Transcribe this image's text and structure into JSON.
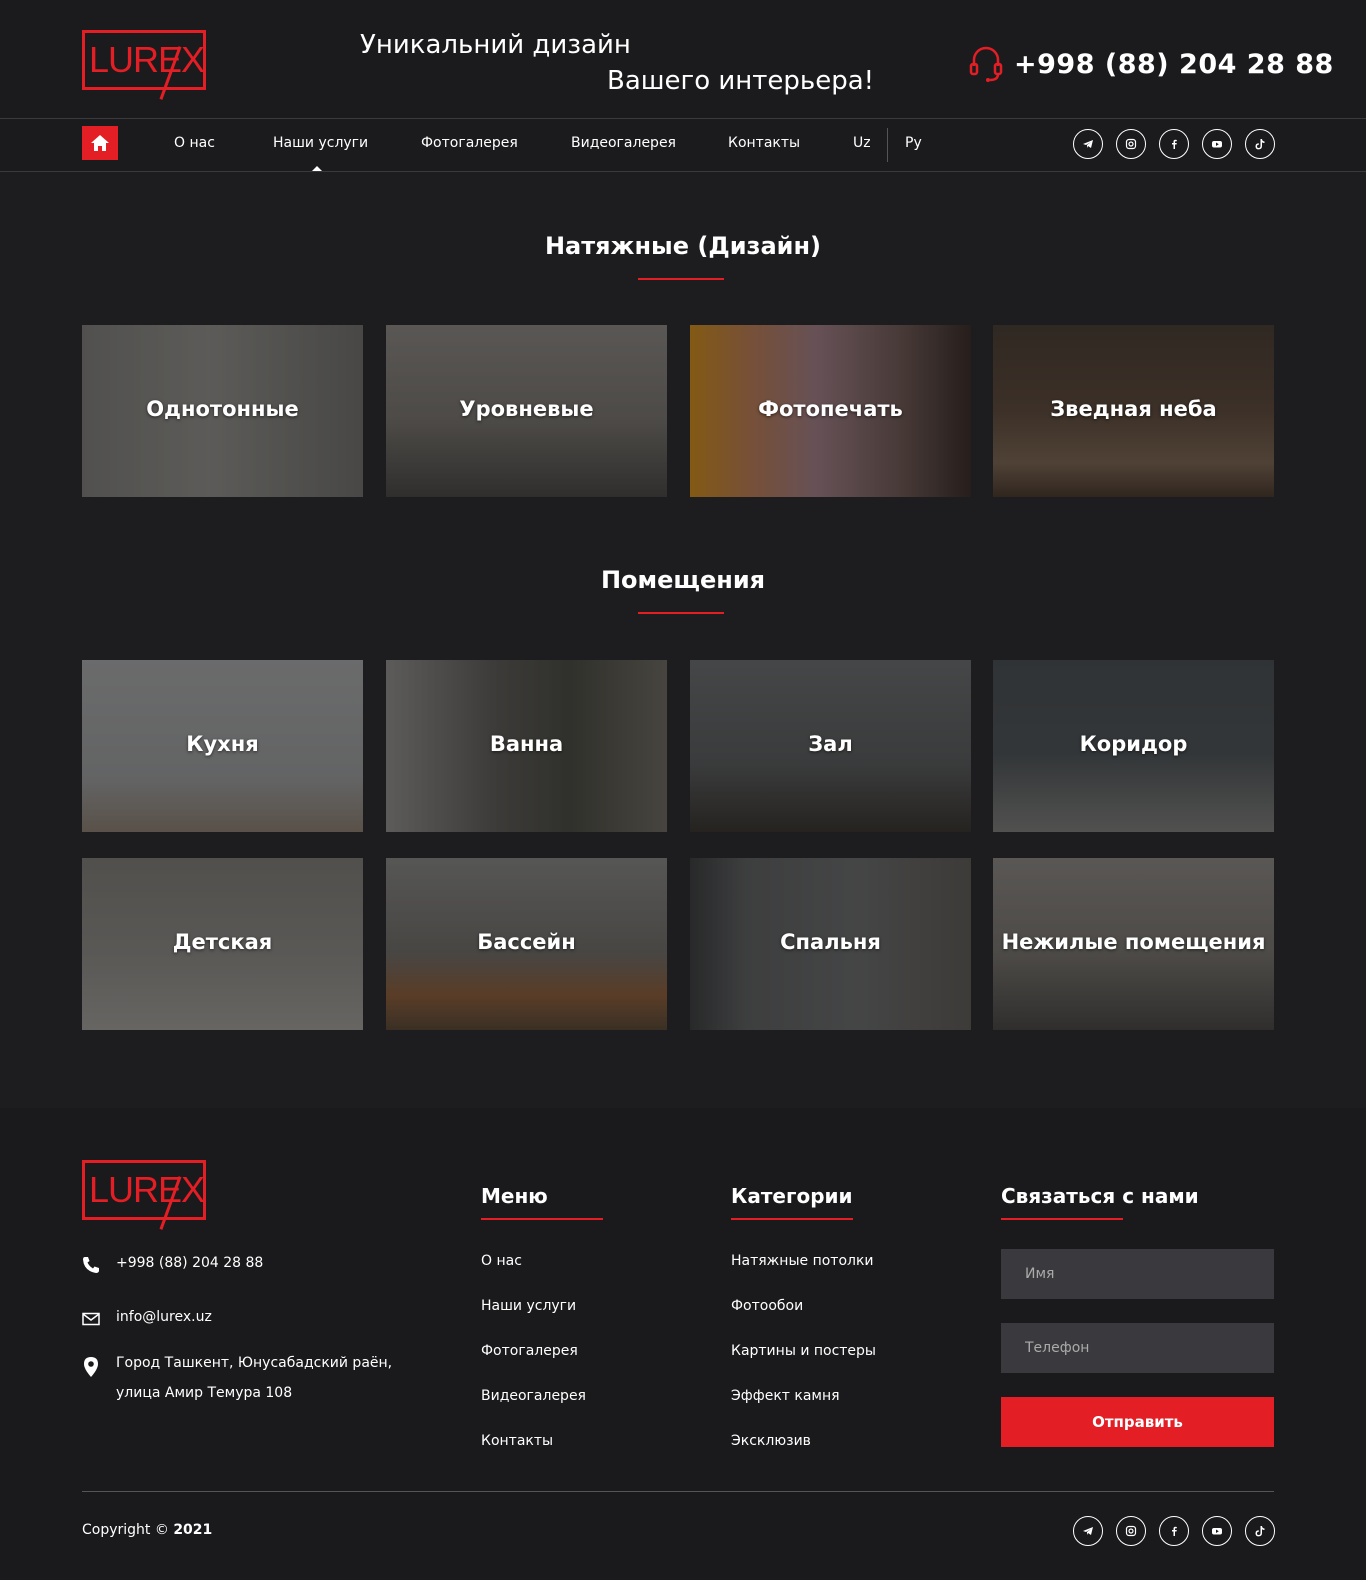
{
  "header": {
    "logo_text": "LUREX",
    "slogan_line1": "Уникальний дизайн",
    "slogan_line2": "Вашего интерьера!",
    "phone": "+998 (88) 204 28 88"
  },
  "nav": {
    "items": [
      "О нас",
      "Наши услуги",
      "Фотогалерея",
      "Видеогалерея",
      "Контакты"
    ],
    "active": "Наши услуги",
    "lang_uz": "Uz",
    "lang_ru": "Ру",
    "social_icons": [
      "telegram-icon",
      "instagram-icon",
      "facebook-icon",
      "youtube-icon",
      "tiktok-icon"
    ]
  },
  "section1": {
    "title": "Натяжные (Дизайн)",
    "cards": [
      "Однотонные",
      "Уровневые",
      "Фотопечать",
      "Зведная неба"
    ]
  },
  "section2": {
    "title": "Помещения",
    "cards": [
      "Кухня",
      "Ванна",
      "Зал",
      "Коридор",
      "Детская",
      "Бассейн",
      "Спальня",
      "Нежилые помещения"
    ]
  },
  "footer": {
    "logo_text": "LUREX",
    "phone": "+998 (88) 204 28 88",
    "email": "info@lurex.uz",
    "address_line1": "Город Ташкент, Юнусабадский раён,",
    "address_line2": "улица Амир Темура 108",
    "menu_title": "Меню",
    "menu_items": [
      "О нас",
      "Наши услуги",
      "Фотогалерея",
      "Видеогалерея",
      "Контакты"
    ],
    "categories_title": "Категории",
    "categories_items": [
      "Натяжные потолки",
      "Фотообои",
      "Картины и постеры",
      "Эффект камня",
      "Эксклюзив"
    ],
    "contact_title": "Связаться с нами",
    "name_placeholder": "Имя",
    "phone_placeholder": "Телефон",
    "submit_label": "Отправить",
    "copyright_prefix": "Copyright ©",
    "copyright_year": "2021"
  },
  "colors": {
    "accent": "#e31e24",
    "background": "#1d1d20"
  }
}
